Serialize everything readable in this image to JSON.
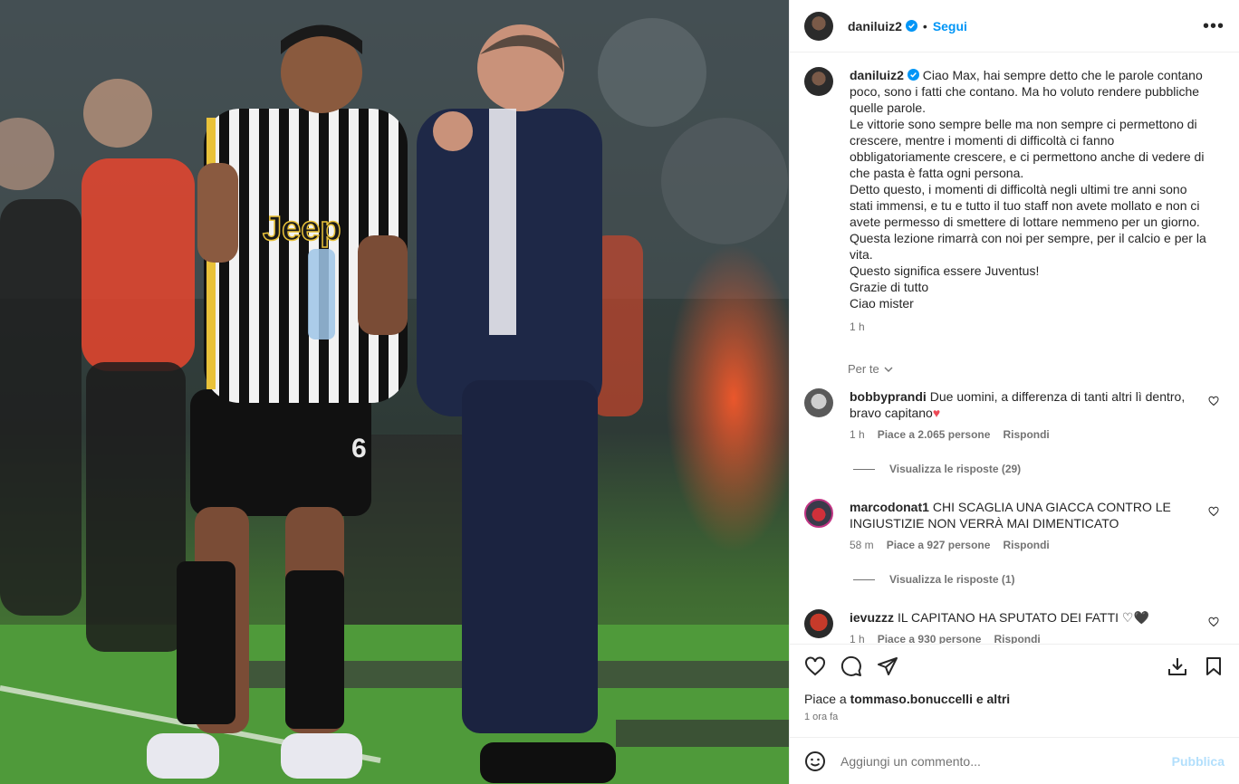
{
  "post": {
    "author": "daniluiz2",
    "follow_label": "Segui",
    "separator": "•",
    "more_label": "•••",
    "caption": "Ciao Max, hai sempre detto che le parole contano poco, sono i fatti che contano. Ma ho voluto rendere pubbliche quelle parole.\nLe vittorie sono sempre belle ma non sempre ci permettono di crescere, mentre i momenti di difficoltà ci fanno obbligatoriamente crescere, e ci permettono anche di vedere di che pasta è fatta ogni persona.\nDetto questo, i momenti di difficoltà negli ultimi tre anni sono stati immensi, e tu e tutto il tuo staff non avete mollato e non ci avete permesso di smettere di lottare nemmeno per un giorno.\nQuesta lezione rimarrà con noi per sempre, per il calcio e per la vita.\nQuesto significa essere Juventus!\nGrazie di tutto\nCiao mister",
    "caption_time": "1 h",
    "per_te_label": "Per te"
  },
  "comments": [
    {
      "user": "bobbyprandi",
      "text": "Due uomini, a differenza di tanti altri lì dentro, bravo capitano",
      "emoji": "♥",
      "time": "1 h",
      "likes": "Piace a 2.065 persone",
      "reply_label": "Rispondi",
      "replies_label": "Visualizza le risposte (29)"
    },
    {
      "user": "marcodonat1",
      "text": "CHI SCAGLIA UNA GIACCA CONTRO LE INGIUSTIZIE NON VERRÀ MAI DIMENTICATO",
      "time": "58 m",
      "likes": "Piace a 927 persone",
      "reply_label": "Rispondi",
      "replies_label": "Visualizza le risposte (1)"
    },
    {
      "user": "ievuzzz",
      "text": "IL CAPITANO HA SPUTATO DEI FATTI ♡🖤",
      "time": "1 h",
      "likes": "Piace a 930 persone",
      "reply_label": "Rispondi"
    }
  ],
  "footer": {
    "likes_prefix": "Piace a ",
    "likes_user": "tommaso.bonuccelli",
    "likes_suffix": " e altri",
    "time": "1 ora fa",
    "comment_placeholder": "Aggiungi un commento...",
    "publish_label": "Pubblica"
  },
  "colors": {
    "link": "#0095f6",
    "muted": "#737373",
    "publish_disabled": "#b2dffc",
    "heart": "#ed4956"
  },
  "photo": {
    "jersey_sponsor": "Jeep",
    "shorts_number": "6"
  }
}
